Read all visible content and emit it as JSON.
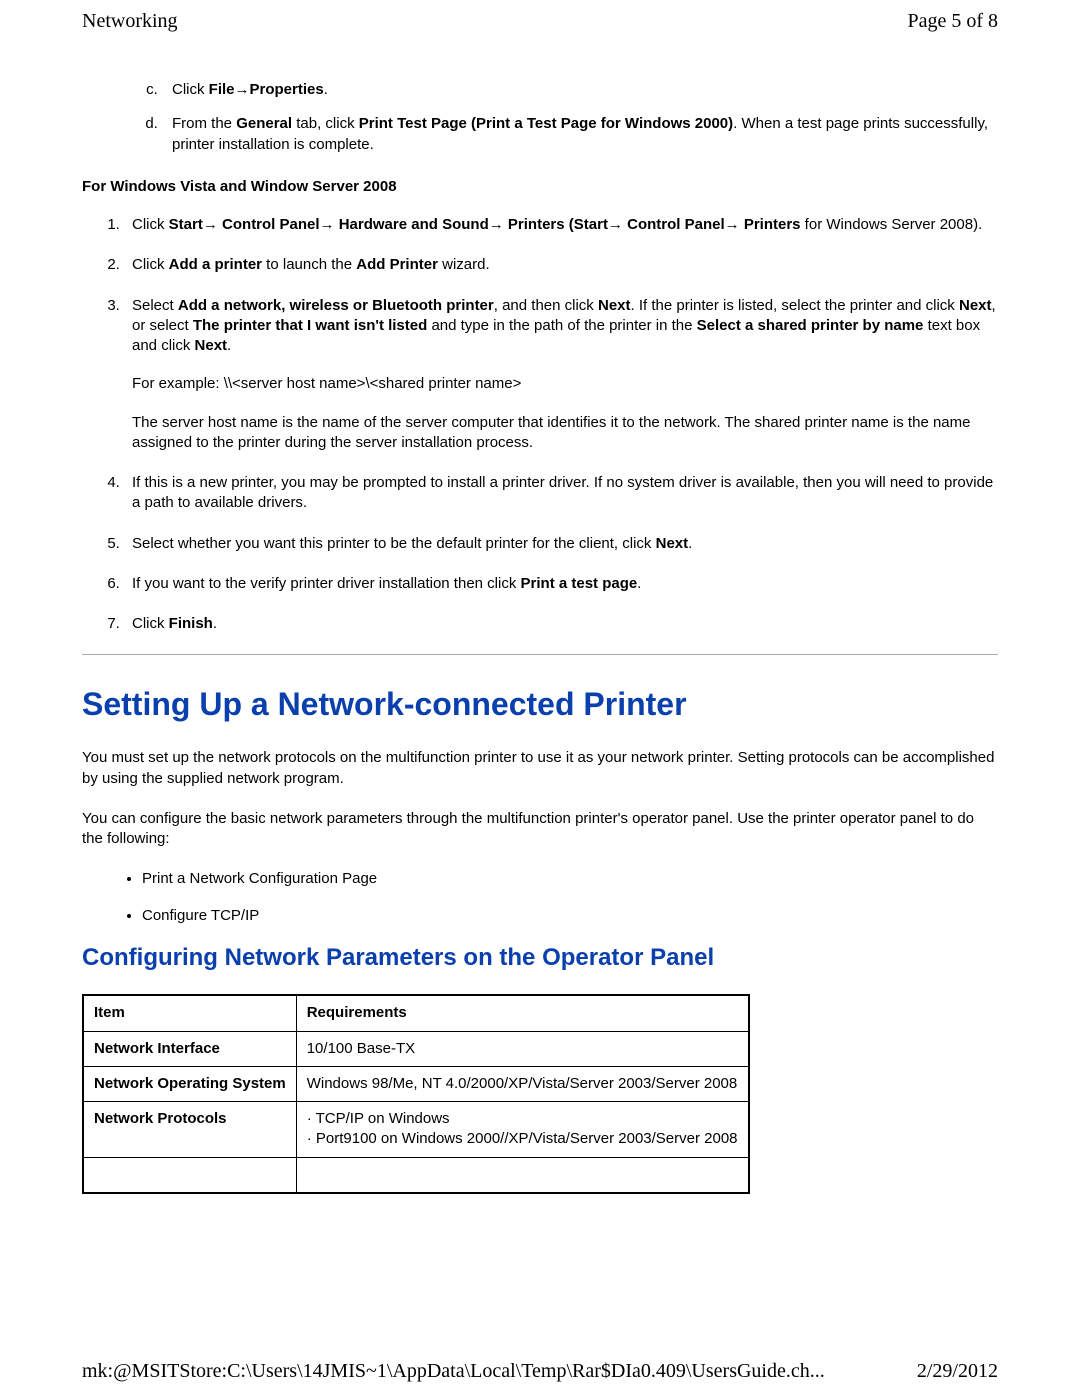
{
  "header": {
    "title": "Networking",
    "page_indicator": "Page 5 of 8"
  },
  "alpha_list": {
    "start": 3,
    "items": [
      {
        "pre": "Click ",
        "b1": "File",
        "arrow1": "→",
        "b2": "Properties",
        "post": "."
      },
      {
        "pre": "From the ",
        "b1": "General",
        "mid": " tab, click ",
        "b2": "Print Test Page (Print a Test Page for Windows 2000)",
        "post": ". When a test page prints successfully, printer installation is complete."
      }
    ]
  },
  "vista_heading": "For Windows Vista and Window Server 2008",
  "num_list": [
    {
      "runs": [
        {
          "t": "Click "
        },
        {
          "t": "Start",
          "b": true
        },
        {
          "t": "→ ",
          "a": true
        },
        {
          "t": "Control Panel",
          "b": true
        },
        {
          "t": "→ ",
          "a": true
        },
        {
          "t": "Hardware and Sound",
          "b": true
        },
        {
          "t": "→ ",
          "a": true
        },
        {
          "t": "Printers (Start",
          "b": true
        },
        {
          "t": "→ ",
          "a": true
        },
        {
          "t": "Control Panel",
          "b": true
        },
        {
          "t": "→ ",
          "a": true
        },
        {
          "t": "Printers",
          "b": true
        },
        {
          "t": " for Windows Server 2008)."
        }
      ]
    },
    {
      "runs": [
        {
          "t": "Click "
        },
        {
          "t": "Add a printer",
          "b": true
        },
        {
          "t": " to launch the "
        },
        {
          "t": "Add Printer",
          "b": true
        },
        {
          "t": " wizard."
        }
      ]
    },
    {
      "runs": [
        {
          "t": "Select "
        },
        {
          "t": "Add a network, wireless or Bluetooth printer",
          "b": true
        },
        {
          "t": ", and then click "
        },
        {
          "t": "Next",
          "b": true
        },
        {
          "t": ". If the printer is listed, select the printer and click "
        },
        {
          "t": "Next",
          "b": true
        },
        {
          "t": ", or select "
        },
        {
          "t": "The printer that I want isn't listed",
          "b": true
        },
        {
          "t": " and type in the path of the printer in the "
        },
        {
          "t": "Select a shared printer by name",
          "b": true
        },
        {
          "t": " text box and click "
        },
        {
          "t": "Next",
          "b": true
        },
        {
          "t": "."
        }
      ],
      "paras": [
        "For example: \\\\<server host name>\\<shared printer name>",
        "The server host name is the name of the server computer that identifies it to the network. The shared printer name is the name assigned to the printer during the server installation process."
      ]
    },
    {
      "runs": [
        {
          "t": "If this is a new printer, you may be prompted to install a printer driver. If no system driver is available, then you will need to provide a path to available drivers."
        }
      ]
    },
    {
      "runs": [
        {
          "t": "Select whether you want this printer to be the default printer for the client, click "
        },
        {
          "t": "Next",
          "b": true
        },
        {
          "t": "."
        }
      ]
    },
    {
      "runs": [
        {
          "t": "If you want to the verify printer driver installation then click "
        },
        {
          "t": "Print a test page",
          "b": true
        },
        {
          "t": "."
        }
      ]
    },
    {
      "runs": [
        {
          "t": "Click "
        },
        {
          "t": "Finish",
          "b": true
        },
        {
          "t": "."
        }
      ]
    }
  ],
  "section_title": "Setting Up a Network-connected Printer",
  "section_paras": [
    "You must set up the network protocols on the multifunction printer to use it as your network printer. Setting protocols can be accomplished by using the supplied network program.",
    "You can configure the basic network parameters through the multifunction printer's operator panel. Use the printer operator panel to do the following:"
  ],
  "bullets": [
    "Print a Network Configuration Page",
    "Configure TCP/IP"
  ],
  "subsection_title": "Configuring Network Parameters on the Operator Panel",
  "table": {
    "headers": [
      "Item",
      "Requirements"
    ],
    "rows": [
      {
        "item": "Network Interface",
        "req": "10/100 Base-TX"
      },
      {
        "item": "Network Operating System",
        "req": "Windows 98/Me, NT 4.0/2000/XP/Vista/Server 2003/Server 2008"
      },
      {
        "item": "Network Protocols",
        "req_lines": [
          "· TCP/IP on Windows",
          "· Port9100 on Windows 2000//XP/Vista/Server 2003/Server 2008"
        ]
      },
      {
        "item": "",
        "req": ""
      }
    ]
  },
  "footer": {
    "path": "mk:@MSITStore:C:\\Users\\14JMIS~1\\AppData\\Local\\Temp\\Rar$DIa0.409\\UsersGuide.ch...",
    "date": "2/29/2012"
  }
}
